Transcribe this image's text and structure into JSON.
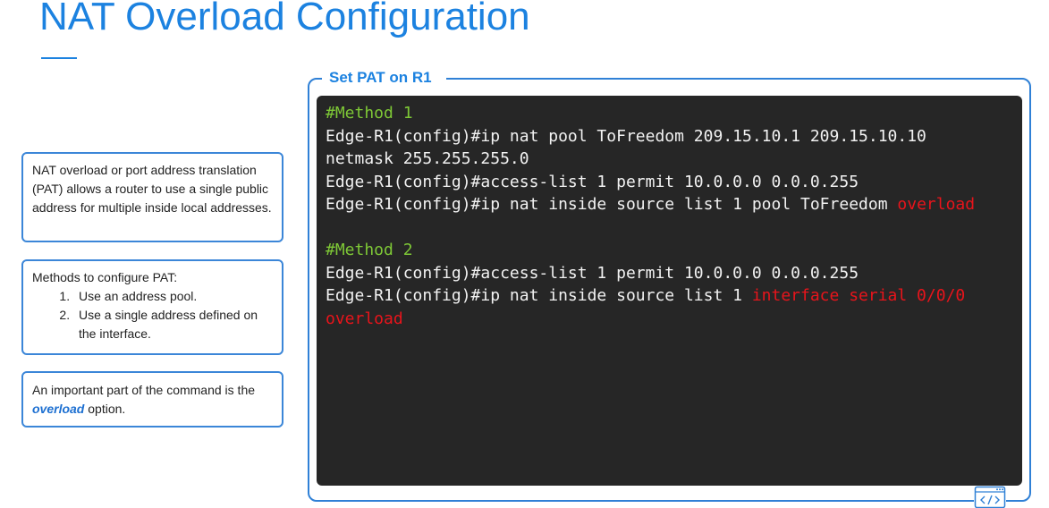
{
  "slide": {
    "title": "NAT Overload Configuration"
  },
  "notes": {
    "note1": "NAT overload or port address translation (PAT) allows a router to use a single public address for multiple inside local addresses.",
    "note2_intro": "Methods to configure PAT:",
    "note2_items": [
      "Use an address pool.",
      "Use a single address defined on the interface."
    ],
    "note3_before": "An important part of the command is the ",
    "note3_emphasis": "overload",
    "note3_after": " option."
  },
  "panel": {
    "label": "Set PAT on R1",
    "lines": {
      "l1": "#Method 1",
      "l2": "Edge-R1(config)#ip nat pool ToFreedom 209.15.10.1 209.15.10.10",
      "l3": "netmask 255.255.255.0",
      "l4": "Edge-R1(config)#access-list 1 permit 10.0.0.0 0.0.0.255",
      "l5a": "Edge-R1(config)#ip nat inside source list 1 pool ToFreedom ",
      "l5b": "overload",
      "l6": "#Method 2",
      "l7": "Edge-R1(config)#access-list 1 permit 10.0.0.0 0.0.0.255",
      "l8a": "Edge-R1(config)#ip nat inside source list 1 ",
      "l8b": "interface serial 0/0/0",
      "l9": "overload"
    }
  },
  "colors": {
    "accent": "#1c82e0",
    "terminal_bg": "#262626",
    "comment": "#7ec836",
    "highlight": "#e8141b"
  },
  "icons": {
    "corner": "code-window-icon"
  }
}
